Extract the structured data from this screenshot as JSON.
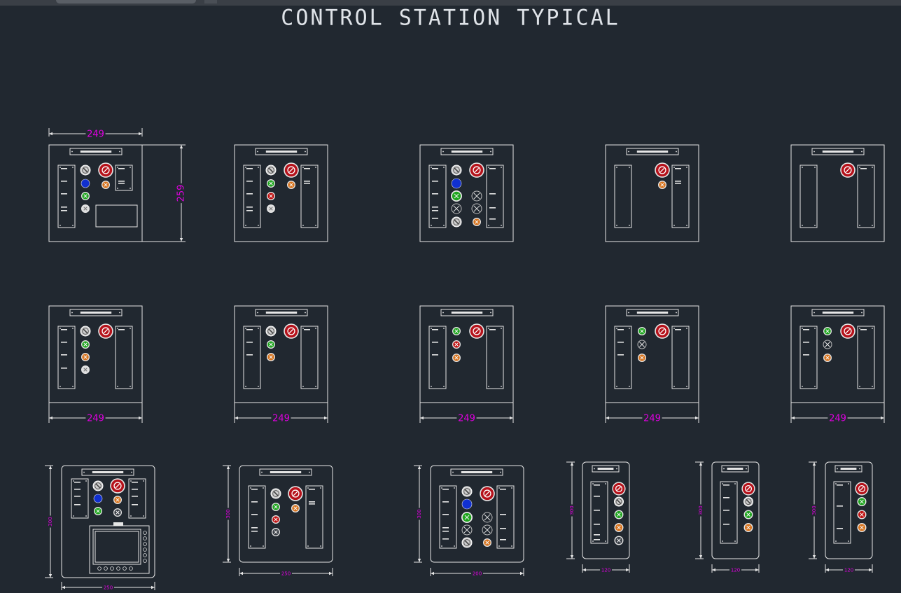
{
  "app": {
    "tab_label": ""
  },
  "drawing": {
    "title": "CONTROL STATION TYPICAL"
  },
  "dimensions": {
    "panel_width": "249",
    "panel_height": "259",
    "small_label_a": "300",
    "small_label_b": "250",
    "small_label_c": "120",
    "small_label_d": "200"
  },
  "colors": {
    "background": "#212830",
    "line": "#e6e6e6",
    "dimension": "#e000e0",
    "emergency_red": "#b5121b",
    "green": "#1ea51e",
    "red": "#c01010",
    "orange": "#d8731c",
    "blue": "#1030d0",
    "white": "#dddddd",
    "dark": "#2a2f36"
  },
  "panels": [
    {
      "id": "p1",
      "comps": [
        "sel",
        "estop",
        "blue",
        "orange",
        "green",
        "white",
        "hmi-rect"
      ]
    },
    {
      "id": "p2",
      "comps": [
        "sel",
        "estop",
        "green",
        "orange",
        "red",
        "white"
      ]
    },
    {
      "id": "p3",
      "comps": [
        "sel",
        "estop",
        "blue",
        "green",
        "off",
        "off",
        "off",
        "off",
        "orange",
        "sel"
      ]
    },
    {
      "id": "p4",
      "comps": [
        "estop",
        "orange"
      ]
    },
    {
      "id": "p5",
      "comps": [
        "estop"
      ]
    },
    {
      "id": "p6",
      "comps": [
        "sel",
        "estop",
        "green",
        "orange",
        "white"
      ]
    },
    {
      "id": "p7",
      "comps": [
        "sel",
        "estop",
        "green",
        "orange"
      ]
    },
    {
      "id": "p8",
      "comps": [
        "green",
        "estop",
        "red",
        "orange"
      ]
    },
    {
      "id": "p9",
      "comps": [
        "green",
        "estop",
        "off",
        "orange"
      ]
    },
    {
      "id": "p10",
      "comps": [
        "green",
        "estop",
        "off",
        "orange"
      ]
    },
    {
      "id": "p11",
      "comps": [
        "sel",
        "estop",
        "blue",
        "orange",
        "green",
        "dark",
        "hmi"
      ]
    },
    {
      "id": "p12",
      "comps": [
        "sel",
        "estop",
        "green",
        "orange",
        "red",
        "dark"
      ]
    },
    {
      "id": "p13",
      "comps": [
        "sel",
        "estop",
        "blue",
        "green",
        "off",
        "off",
        "off",
        "off",
        "orange",
        "sel"
      ]
    },
    {
      "id": "p14",
      "comps": [
        "estop",
        "sel",
        "green",
        "orange",
        "dark"
      ]
    },
    {
      "id": "p15",
      "comps": [
        "estop",
        "sel",
        "green",
        "orange"
      ]
    },
    {
      "id": "p16",
      "comps": [
        "estop",
        "green",
        "red",
        "orange"
      ]
    }
  ]
}
